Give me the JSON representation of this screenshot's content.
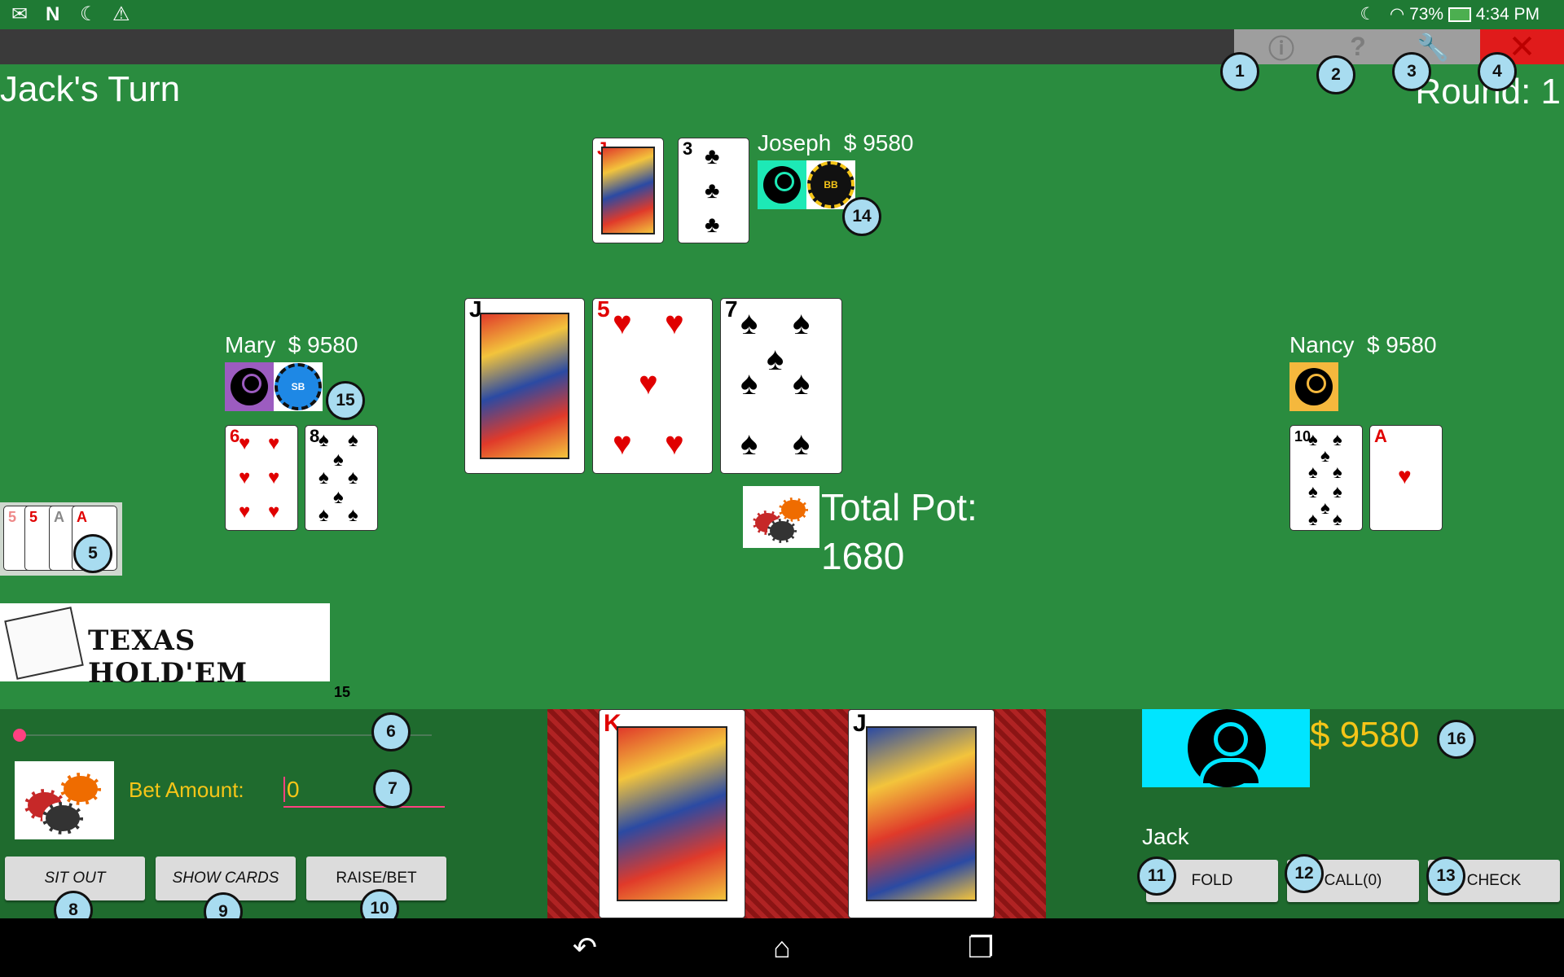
{
  "status_bar": {
    "left_icons": [
      "gmail-icon",
      "n-icon",
      "moon-icon",
      "warning-icon"
    ],
    "battery": "73%",
    "time": "4:34 PM"
  },
  "toolbar": {
    "buttons": [
      "info-icon",
      "help-icon",
      "settings-wrench-icon",
      "close-icon"
    ]
  },
  "game": {
    "turn_label": "Jack's Turn",
    "round_label": "Round: 1",
    "total_pot_label": "Total Pot:",
    "total_pot_value": "1680",
    "logo_text": "TEXAS HOLD'EM",
    "slider_max_label": "15"
  },
  "players": {
    "joseph": {
      "name": "Joseph",
      "money": "$ 9580",
      "blind": "BB",
      "avatar_color": "#1de9b6",
      "cards": [
        {
          "rank": "J",
          "suit": "♥",
          "color": "red"
        },
        {
          "rank": "3",
          "suit": "♣",
          "color": "blk"
        }
      ]
    },
    "mary": {
      "name": "Mary",
      "money": "$ 9580",
      "blind": "SB",
      "avatar_color": "#9c5cc0",
      "cards": [
        {
          "rank": "6",
          "suit": "♥",
          "color": "red"
        },
        {
          "rank": "8",
          "suit": "♠",
          "color": "blk"
        }
      ]
    },
    "nancy": {
      "name": "Nancy",
      "money": "$ 9580",
      "avatar_color": "#f5b83d",
      "cards": [
        {
          "rank": "10",
          "suit": "♠",
          "color": "blk"
        },
        {
          "rank": "A",
          "suit": "♥",
          "color": "red"
        }
      ]
    },
    "jack": {
      "name": "Jack",
      "money": "$ 9580",
      "avatar_color": "#00e5ff",
      "cards": [
        {
          "rank": "K",
          "suit": "♥",
          "color": "red"
        },
        {
          "rank": "J",
          "suit": "♣",
          "color": "blk"
        }
      ]
    }
  },
  "community_cards": [
    {
      "rank": "J",
      "suit": "♠",
      "color": "blk"
    },
    {
      "rank": "5",
      "suit": "♥",
      "color": "red"
    },
    {
      "rank": "7",
      "suit": "♠",
      "color": "blk"
    }
  ],
  "hand_rank_cards": [
    "5",
    "5",
    "A",
    "A"
  ],
  "controls": {
    "bet_label": "Bet Amount:",
    "bet_value": "0",
    "sit_out": "SIT OUT",
    "show_cards": "SHOW CARDS",
    "raise_bet": "RAISE/BET",
    "fold": "FOLD",
    "call": "CALL(0)",
    "check": "CHECK"
  },
  "annotations": [
    "1",
    "2",
    "3",
    "4",
    "5",
    "6",
    "7",
    "8",
    "9",
    "10",
    "11",
    "12",
    "13",
    "14",
    "15",
    "16"
  ]
}
